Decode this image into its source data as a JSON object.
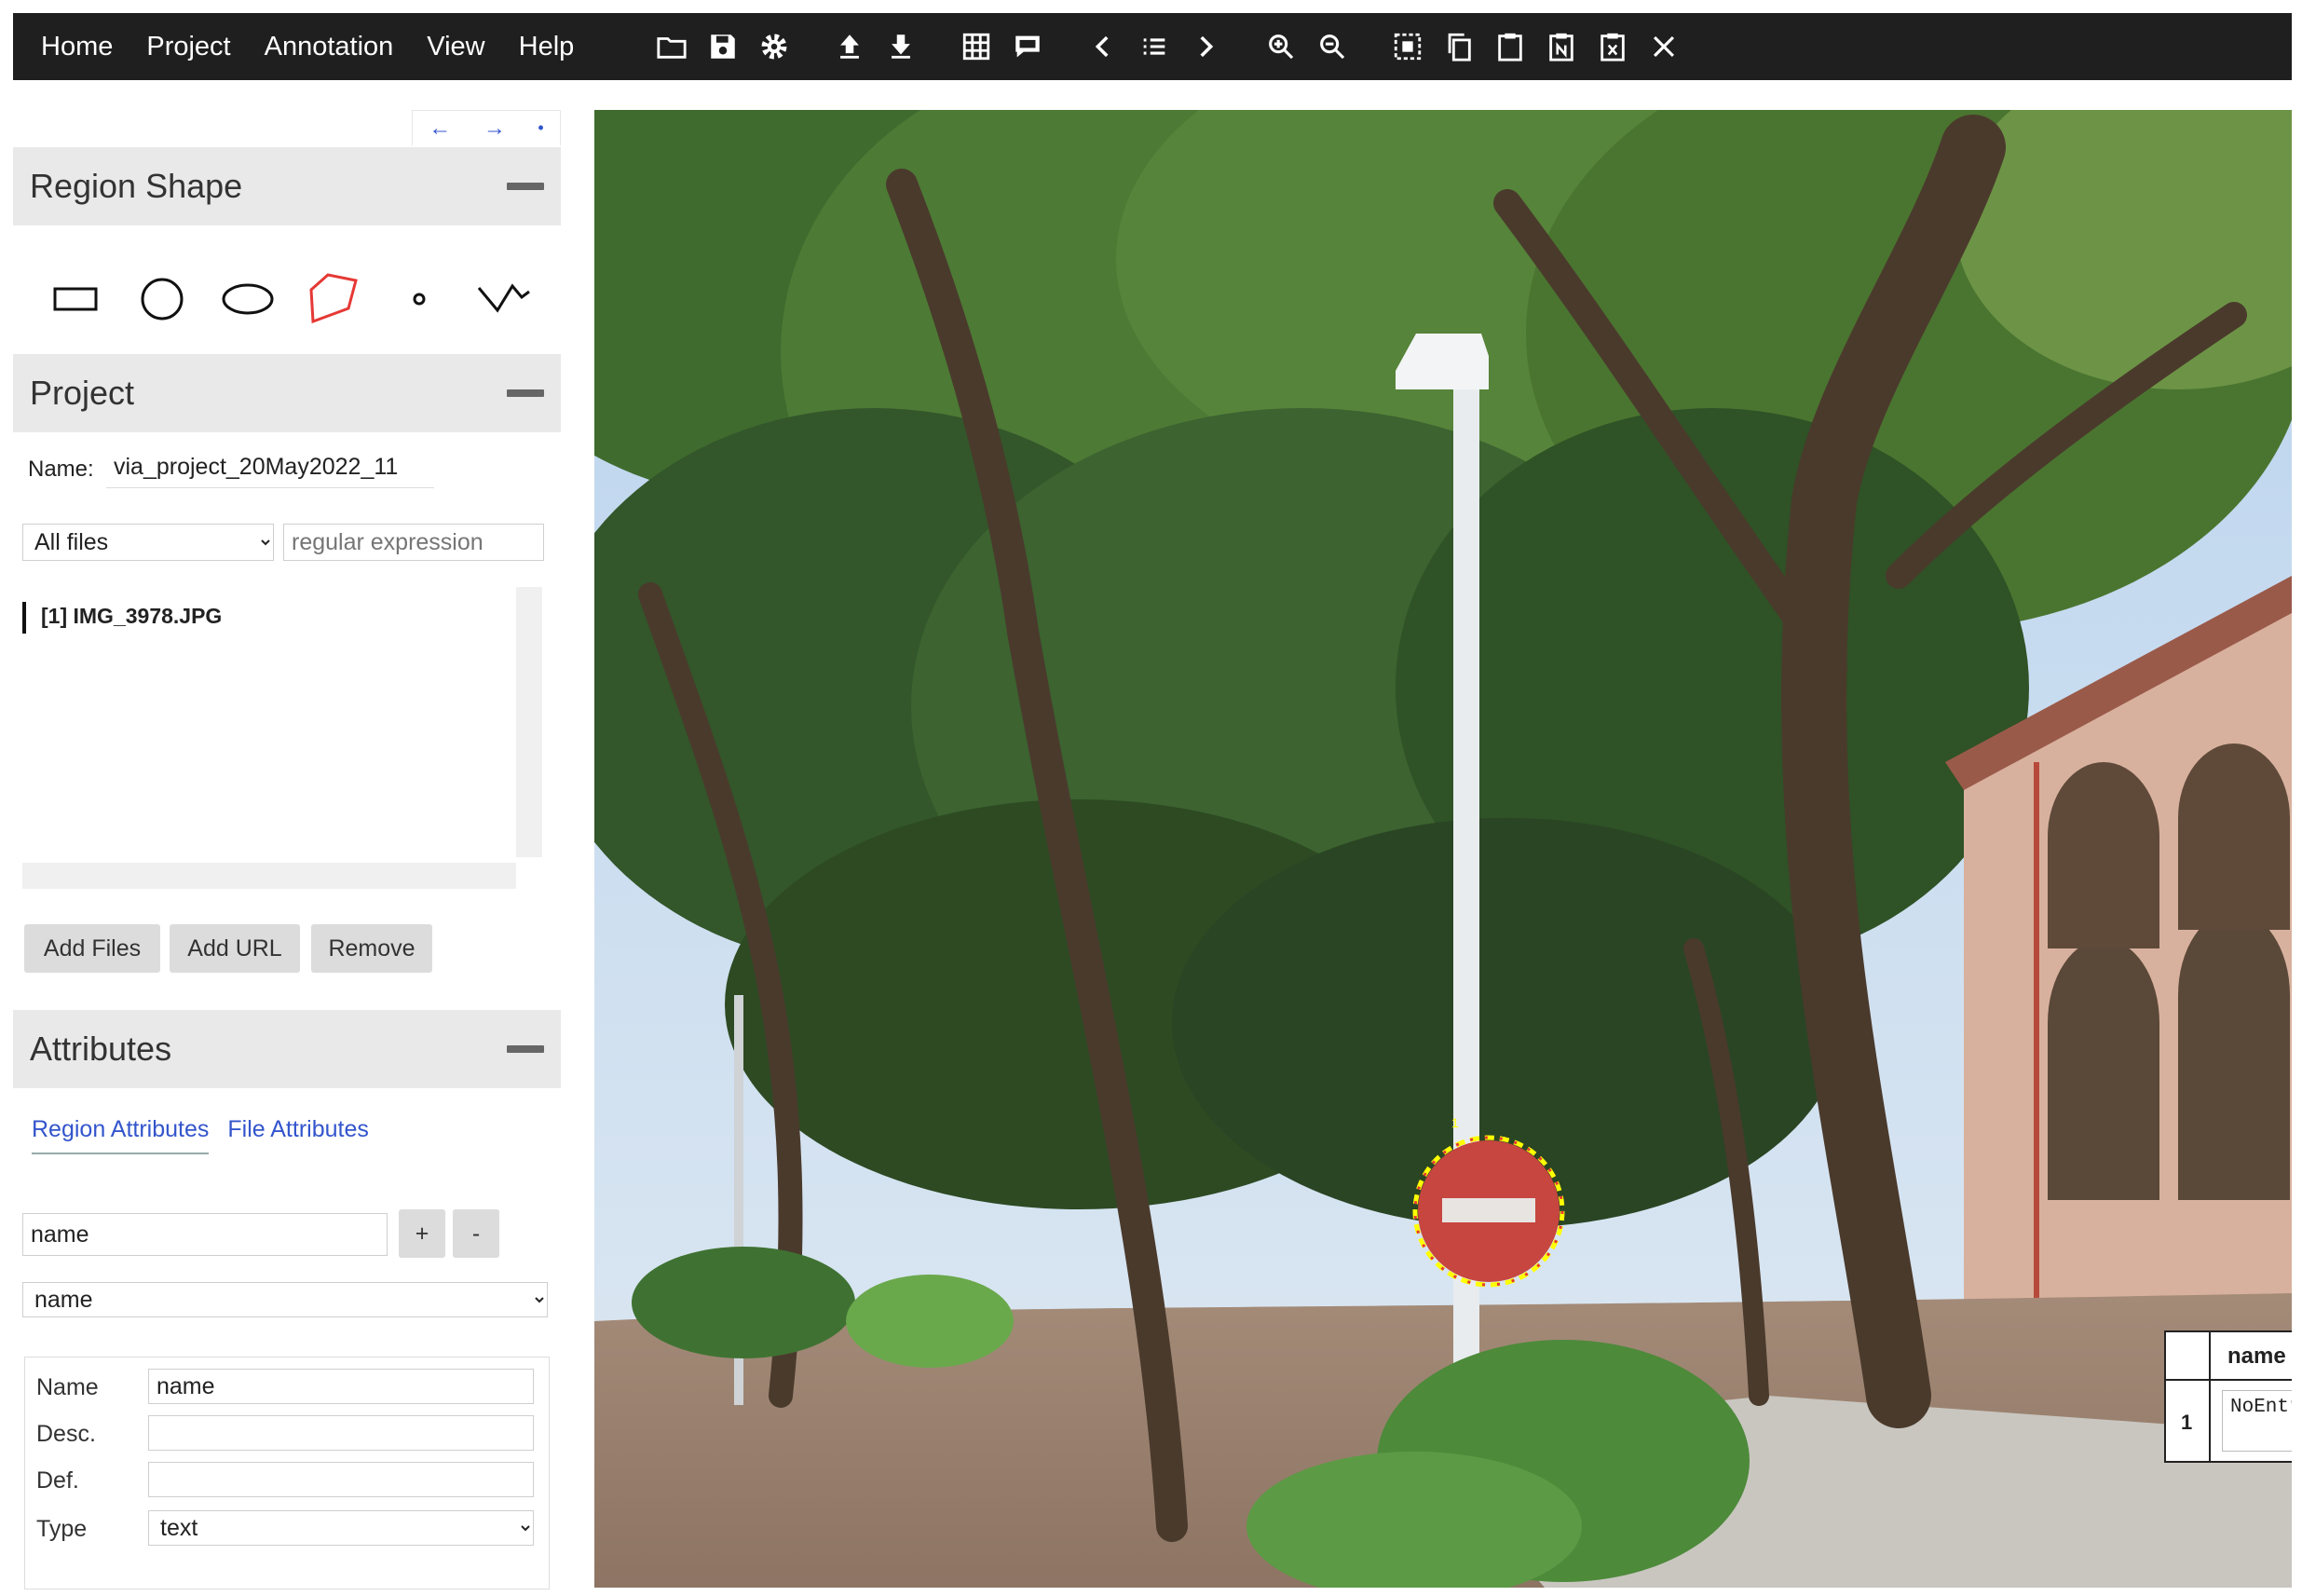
{
  "menu": {
    "items": [
      "Home",
      "Project",
      "Annotation",
      "View",
      "Help"
    ]
  },
  "toolbar": {
    "icons": [
      "folder-open-icon",
      "save-icon",
      "settings-icon",
      "upload-icon",
      "download-icon",
      "grid-view-icon",
      "comment-icon",
      "previous-icon",
      "list-icon",
      "next-icon",
      "zoom-in-icon",
      "zoom-out-icon",
      "select-all-icon",
      "copy-icon",
      "paste-icon",
      "paste-n-icon",
      "delete-region-icon",
      "close-icon"
    ]
  },
  "panel_nav": {
    "left": "←",
    "right": "→",
    "dot": "•"
  },
  "region_shape": {
    "title": "Region Shape",
    "shapes": [
      "rectangle",
      "circle",
      "ellipse",
      "polygon",
      "point",
      "polyline"
    ],
    "selected": "polygon"
  },
  "project": {
    "title": "Project",
    "name_label": "Name:",
    "name_value": "via_project_20May2022_11",
    "filter_selected": "All files",
    "regex_placeholder": "regular expression",
    "files": [
      "[1] IMG_3978.JPG"
    ],
    "buttons": {
      "add_files": "Add Files",
      "add_url": "Add URL",
      "remove": "Remove"
    }
  },
  "attributes": {
    "title": "Attributes",
    "tabs": {
      "region": "Region Attributes",
      "file": "File Attributes"
    },
    "new_attr_value": "name",
    "add_label": "+",
    "remove_label": "-",
    "selected_attr": "name",
    "fields": {
      "name_label": "Name",
      "name_value": "name",
      "desc_label": "Desc.",
      "def_label": "Def.",
      "type_label": "Type",
      "type_value": "text"
    }
  },
  "annotation": {
    "header": "name",
    "row_index": "1",
    "value": "NoEntry"
  },
  "colors": {
    "topbar": "#1f1f1f",
    "polygon_selected": "#e53935",
    "region_outline": "#ffff00",
    "link": "#3355cc"
  }
}
